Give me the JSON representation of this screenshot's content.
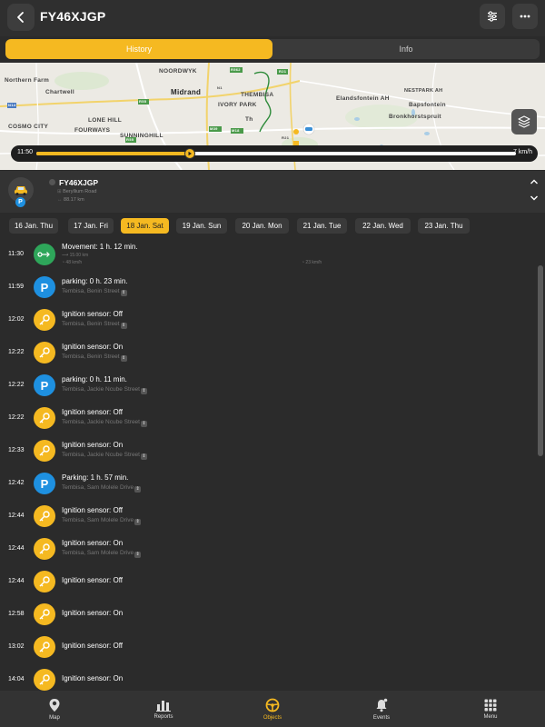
{
  "header": {
    "title": "FY46XJGP",
    "back_icon": "chevron-left-icon",
    "filter_icon": "sliders-icon",
    "more_icon": "more-horizontal-icon"
  },
  "tabs": [
    {
      "label": "History",
      "active": true
    },
    {
      "label": "Info",
      "active": false
    }
  ],
  "map": {
    "labels": [
      "NOORDWYK",
      "Midrand",
      "Northern Farm",
      "Chartwell",
      "THEMBISA",
      "IVORY PARK",
      "Elandsfontein AH",
      "NESTPARK AH",
      "Bapsfontein",
      "Bronkhorstspruit",
      "COSMO CITY",
      "LONE HILL",
      "FOURWAYS",
      "SUNNINGHILL",
      "Th"
    ],
    "road_labels": [
      "R562",
      "R21",
      "N1",
      "R55",
      "M39",
      "M18",
      "R55",
      "R21",
      "N14"
    ],
    "layers_icon": "layers-icon"
  },
  "player": {
    "time": "11:50",
    "speed": "7 km/h",
    "progress": 0.32,
    "play_icon": "play-icon"
  },
  "vehicle": {
    "name": "FY46XJGP",
    "address": "Beryllium Road",
    "distance": "88.17 km",
    "badge": "P",
    "avatar_icon": "car-icon"
  },
  "dates": [
    {
      "label": "16 Jan. Thu",
      "active": false
    },
    {
      "label": "17 Jan. Fri",
      "active": false
    },
    {
      "label": "18 Jan. Sat",
      "active": true
    },
    {
      "label": "19 Jan. Sun",
      "active": false
    },
    {
      "label": "20 Jan. Mon",
      "active": false
    },
    {
      "label": "21 Jan. Tue",
      "active": false
    },
    {
      "label": "22 Jan. Wed",
      "active": false
    },
    {
      "label": "23 Jan. Thu",
      "active": false
    }
  ],
  "events": [
    {
      "time": "11:30",
      "type": "move",
      "title": "Movement: 1 h. 12 min.",
      "distance": "15.00 km",
      "max_speed": "48 km/h",
      "avg_speed": "23 km/h"
    },
    {
      "time": "11:59",
      "type": "park",
      "title": "parking: 0 h. 23 min.",
      "address": "Tembisa, Benin Street"
    },
    {
      "time": "12:02",
      "type": "key",
      "title": "Ignition sensor: Off",
      "address": "Tembisa, Benin Street"
    },
    {
      "time": "12:22",
      "type": "key",
      "title": "Ignition sensor: On",
      "address": "Tembisa, Benin Street"
    },
    {
      "time": "12:22",
      "type": "park",
      "title": "parking: 0 h. 11 min.",
      "address": "Tembisa, Jackie Ncube Street"
    },
    {
      "time": "12:22",
      "type": "key",
      "title": "Ignition sensor: Off",
      "address": "Tembisa, Jackie Ncube Street"
    },
    {
      "time": "12:33",
      "type": "key",
      "title": "Ignition sensor: On",
      "address": "Tembisa, Jackie Ncube Street"
    },
    {
      "time": "12:42",
      "type": "park",
      "title": "Parking: 1 h. 57 min.",
      "address": "Tembisa, Sam Molele Drive"
    },
    {
      "time": "12:44",
      "type": "key",
      "title": "Ignition sensor: Off",
      "address": "Tembisa, Sam Molele Drive"
    },
    {
      "time": "12:44",
      "type": "key",
      "title": "Ignition sensor: On",
      "address": "Tembisa, Sam Molele Drive"
    },
    {
      "time": "12:44",
      "type": "key",
      "title": "Ignition sensor: Off",
      "address": ""
    },
    {
      "time": "12:58",
      "type": "key",
      "title": "Ignition sensor: On",
      "address": ""
    },
    {
      "time": "13:02",
      "type": "key",
      "title": "Ignition sensor: Off",
      "address": ""
    },
    {
      "time": "14:04",
      "type": "key",
      "title": "Ignition sensor: On",
      "address": ""
    }
  ],
  "nav": [
    {
      "label": "Map",
      "icon": "map-pin-icon",
      "active": false
    },
    {
      "label": "Reports",
      "icon": "bar-chart-icon",
      "active": false
    },
    {
      "label": "Objects",
      "icon": "steering-wheel-icon",
      "active": true
    },
    {
      "label": "Events",
      "icon": "bell-icon",
      "active": false
    },
    {
      "label": "Menu",
      "icon": "grid-icon",
      "active": false
    }
  ],
  "colors": {
    "accent": "#f5b921",
    "parking": "#1e90e0",
    "movement": "#2ea65a",
    "background": "#2b2b2b",
    "route": "#2e8b3a"
  }
}
